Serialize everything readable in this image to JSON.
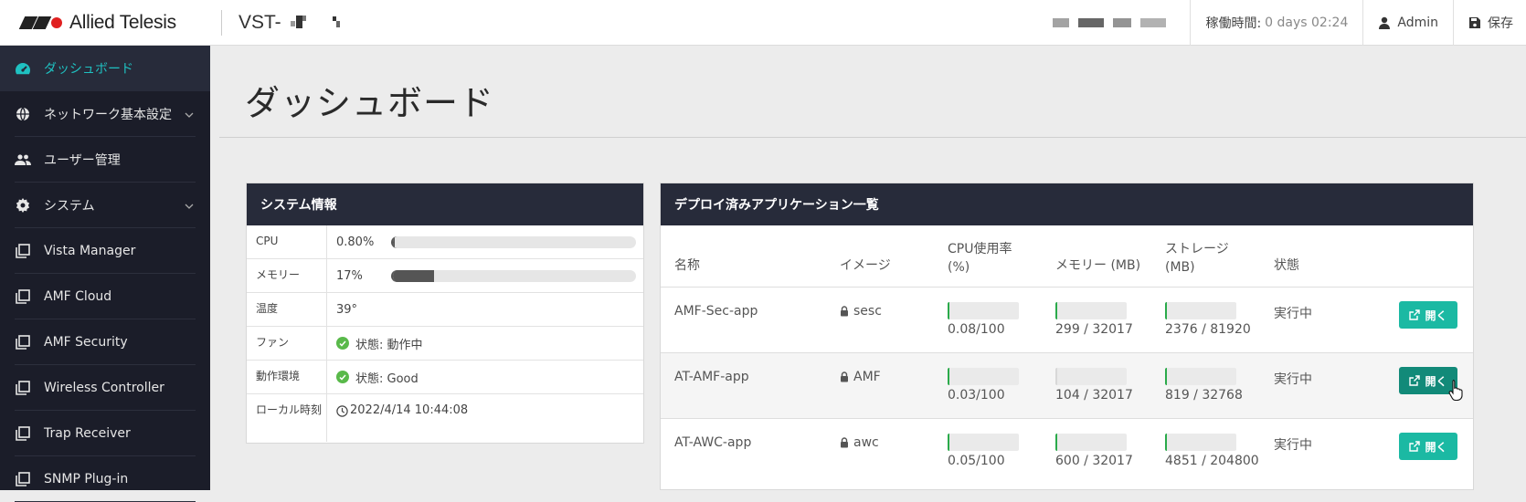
{
  "header": {
    "brand": "Allied Telesis",
    "product": "VST-",
    "uptime_label": "稼働時間:",
    "uptime_value": "0 days 02:24",
    "user": "Admin",
    "save": "保存",
    "icons": [
      "user-icon",
      "save-icon"
    ]
  },
  "sidebar": {
    "items": [
      {
        "label": "ダッシュボード",
        "icon": "dashboard-icon",
        "active": true
      },
      {
        "label": "ネットワーク基本設定",
        "icon": "globe-icon",
        "expandable": true
      },
      {
        "label": "ユーザー管理",
        "icon": "users-icon"
      },
      {
        "label": "システム",
        "icon": "gear-icon",
        "expandable": true
      },
      {
        "label": "Vista Manager",
        "icon": "window-icon"
      },
      {
        "label": "AMF Cloud",
        "icon": "window-icon"
      },
      {
        "label": "AMF Security",
        "icon": "window-icon"
      },
      {
        "label": "Wireless Controller",
        "icon": "window-icon"
      },
      {
        "label": "Trap Receiver",
        "icon": "window-icon"
      },
      {
        "label": "SNMP Plug-in",
        "icon": "window-icon"
      }
    ]
  },
  "page": {
    "title": "ダッシュボード"
  },
  "sysinfo": {
    "title": "システム情報",
    "cpu": {
      "label": "CPU",
      "value": "0.80%",
      "fraction": 0.008
    },
    "memory": {
      "label": "メモリー",
      "value": "17%",
      "fraction": 0.17
    },
    "temp": {
      "label": "温度",
      "value": "39°"
    },
    "fan": {
      "label": "ファン",
      "value": "状態: 動作中"
    },
    "env": {
      "label": "動作環境",
      "value": "状態: Good"
    },
    "time": {
      "label": "ローカル時刻",
      "value": "2022/4/14 10:44:08"
    }
  },
  "apps": {
    "title": "デプロイ済みアプリケーション一覧",
    "columns": {
      "name": "名称",
      "image": "イメージ",
      "cpu_line1": "CPU使用率",
      "cpu_line2": "(%)",
      "mem": "メモリー (MB)",
      "storage_line1": "ストレージ",
      "storage_line2": "(MB)",
      "state": "状態"
    },
    "open_label": "開く",
    "rows": [
      {
        "name": "AMF-Sec-app",
        "image": "sesc",
        "cpu": "0.08/100",
        "cpu_f": 0.0008,
        "mem": "299 / 32017",
        "mem_f": 0.009,
        "storage": "2376 / 81920",
        "storage_f": 0.029,
        "state": "実行中"
      },
      {
        "name": "AT-AMF-app",
        "image": "AMF",
        "cpu": "0.03/100",
        "cpu_f": 0.0003,
        "mem": "104 / 32017",
        "mem_f": 0.003,
        "storage": "819 / 32768",
        "storage_f": 0.025,
        "state": "実行中"
      },
      {
        "name": "AT-AWC-app",
        "image": "awc",
        "cpu": "0.05/100",
        "cpu_f": 0.0005,
        "mem": "600 / 32017",
        "mem_f": 0.019,
        "storage": "4851 / 204800",
        "storage_f": 0.024,
        "state": "実行中"
      }
    ]
  }
}
